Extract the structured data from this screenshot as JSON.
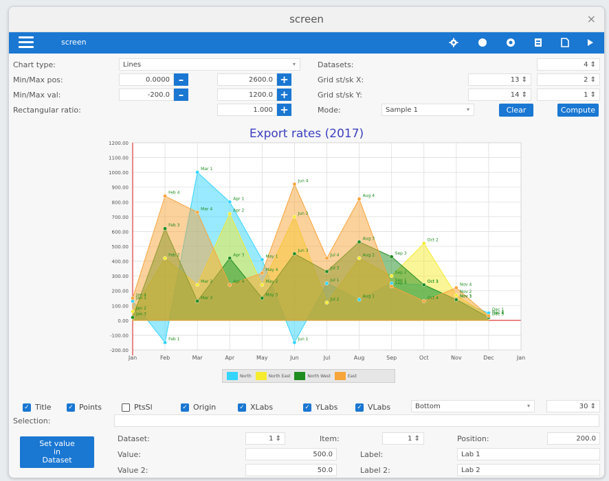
{
  "window": {
    "title": "screen",
    "close": "×"
  },
  "toolbar": {
    "title": "screen",
    "icons": [
      "gear-icon",
      "circle-icon",
      "globe-icon",
      "save-file-icon",
      "new-file-icon",
      "play-icon"
    ]
  },
  "form": {
    "chart_type_label": "Chart type:",
    "chart_type_value": "Lines",
    "minmax_pos_label": "Min/Max pos:",
    "min_pos": "0.0000",
    "max_pos": "2600.0",
    "minmax_val_label": "Min/Max val:",
    "min_val": "-200.0",
    "max_val": "1200.0",
    "rect_ratio_label": "Rectangular ratio:",
    "rect_ratio": "1.000",
    "datasets_label": "Datasets:",
    "datasets": "4",
    "grid_x_label": "Grid st/sk X:",
    "grid_x_st": "13",
    "grid_x_sk": "2",
    "grid_y_label": "Grid st/sk Y:",
    "grid_y_st": "14",
    "grid_y_sk": "1",
    "mode_label": "Mode:",
    "mode_value": "Sample 1",
    "clear": "Clear",
    "compute": "Compute"
  },
  "options": {
    "title": "Title",
    "points": "Points",
    "ptsel": "PtsSl",
    "origin": "Origin",
    "xlabs": "XLabs",
    "ylabs": "YLabs",
    "vlabs": "VLabs",
    "position": "Bottom",
    "count": "30",
    "checked": {
      "title": true,
      "points": true,
      "ptsel": false,
      "origin": true,
      "xlabs": true,
      "ylabs": true,
      "vlabs": true
    }
  },
  "selection": {
    "label": "Selection:",
    "value": ""
  },
  "bottom": {
    "set_value": [
      "Set value",
      "in",
      "Dataset"
    ],
    "dataset_label": "Dataset:",
    "dataset": "1",
    "item_label": "Item:",
    "item": "1",
    "position_label": "Position:",
    "position": "200.0",
    "value_label": "Value:",
    "value": "500.0",
    "label_label": "Label:",
    "label": "Lab 1",
    "value2_label": "Value 2:",
    "value2": "50.0",
    "label2_label": "Label 2:",
    "label2": "Lab 2"
  },
  "chart_data": {
    "type": "area",
    "title": "Export rates (2017)",
    "categories": [
      "Jan",
      "Feb",
      "Mar",
      "Apr",
      "May",
      "Jun",
      "Jul",
      "Aug",
      "Sep",
      "Oct",
      "Nov",
      "Dec",
      "Jan"
    ],
    "ylim": [
      -200,
      1200
    ],
    "yticks": [
      1200,
      1100,
      1000,
      900,
      800,
      700,
      600,
      500,
      400,
      300,
      200,
      100,
      0,
      -100,
      -200
    ],
    "series": [
      {
        "name": "North",
        "color": "#33d4ff",
        "values": [
          130,
          -150,
          1000,
          800,
          410,
          -150,
          250,
          140,
          250,
          240,
          140,
          50
        ],
        "labels": [
          "Jan 1",
          "Feb 1",
          "Mar 1",
          "Apr 1",
          "May 1",
          "Jun 1",
          "Jul 1",
          "Aug 1",
          "Sep 1",
          "Oct 1",
          "Nov 1",
          "Dec 1"
        ]
      },
      {
        "name": "North East",
        "color": "#f5ec30",
        "values": [
          60,
          420,
          240,
          720,
          240,
          700,
          120,
          420,
          300,
          520,
          170,
          30
        ],
        "labels": [
          "Jan 2",
          "Feb 2",
          "Mar 2",
          "Apr 2",
          "May 2",
          "Jun 2",
          "Jul 2",
          "Aug 2",
          "Sep 2",
          "Oct 2",
          "Nov 2",
          "Dec 2"
        ]
      },
      {
        "name": "North West",
        "color": "#1f8c1f",
        "values": [
          20,
          620,
          130,
          420,
          150,
          450,
          330,
          530,
          430,
          240,
          140,
          20
        ],
        "labels": [
          "Jan 3",
          "Feb 3",
          "Mar 3",
          "Apr 3",
          "May 3",
          "Jun 3",
          "Jul 3",
          "Aug 3",
          "Sep 3",
          "Oct 3",
          "Nov 3",
          "Dec 3"
        ]
      },
      {
        "name": "East",
        "color": "#f7a43a",
        "values": [
          150,
          840,
          730,
          240,
          320,
          920,
          420,
          820,
          230,
          130,
          220,
          30
        ],
        "labels": [
          "Jan 4",
          "Feb 4",
          "Mar 4",
          "Apr 4",
          "May 4",
          "Jun 4",
          "Jul 4",
          "Aug 4",
          "Sep 4",
          "Oct 4",
          "Nov 4",
          "Dec 4"
        ]
      }
    ]
  }
}
